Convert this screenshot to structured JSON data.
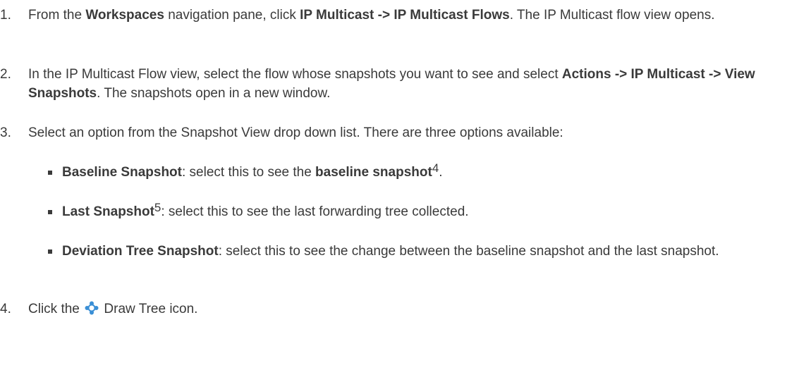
{
  "steps": [
    {
      "num": "1.",
      "t1": "From the ",
      "b1": "Workspaces",
      "t2": " navigation pane, click ",
      "b2": "IP Multicast -> IP Multicast Flows",
      "t3": ". The IP Multicast flow view opens."
    },
    {
      "num": "2.",
      "t1": "In the IP Multicast Flow view, select the flow whose snapshots you want to see and select ",
      "b1": "Actions -> IP Multicast -> View Snapshots",
      "t2": ". The snapshots open in a new window."
    },
    {
      "num": "3.",
      "t1": "Select an option from the Snapshot View drop down list. There are three options available:"
    },
    {
      "num": "4.",
      "t1": "Click the ",
      "icon": "draw-tree-icon",
      "t2": " Draw Tree icon."
    }
  ],
  "options": [
    {
      "b1": "Baseline Snapshot",
      "t1": ": select this to see the ",
      "b2": "baseline snapshot",
      "sup": "4",
      "t2": "."
    },
    {
      "b1": "Last Snapshot",
      "sup": "5",
      "t1": ": select this to see the last forwarding tree collected."
    },
    {
      "b1": "Deviation Tree Snapshot",
      "t1": ": select this to see the change between the baseline snapshot and the last snapshot."
    }
  ],
  "colors": {
    "text": "#3a3a3a",
    "icon": "#3a8fd6"
  }
}
